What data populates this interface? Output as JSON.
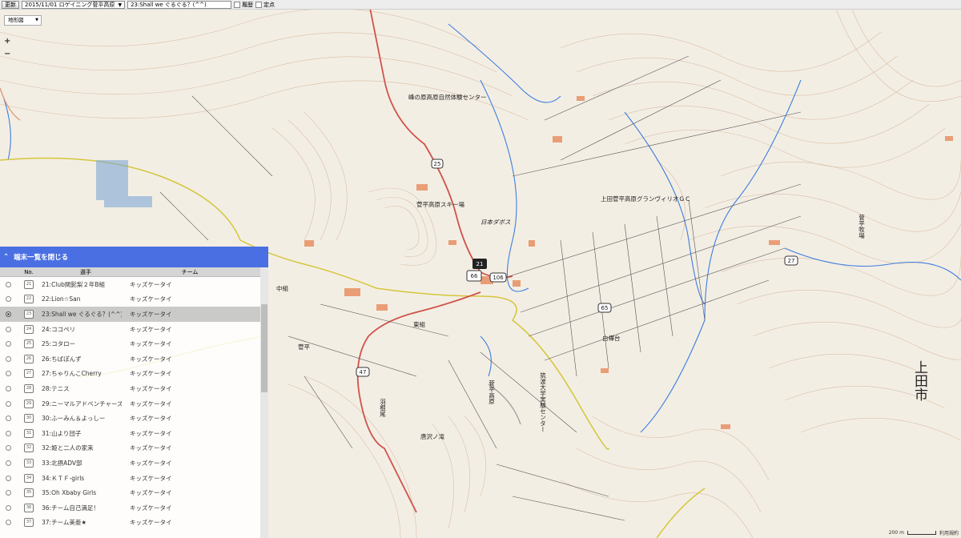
{
  "toolbar": {
    "update_label": "更新",
    "event_select": "2015/11/01 ロゲイニング菅平高原",
    "player_select": "23:Shall we ぐるぐる？(^^)",
    "history_label": "履歴",
    "fixed_point_label": "定点"
  },
  "layer_select": "地形図",
  "zoom": {
    "in": "+",
    "out": "−"
  },
  "panel": {
    "header": "端末一覧を閉じる",
    "toggle_icon": "chevron-up-icon",
    "columns": {
      "no": "No.",
      "player": "選手",
      "team": "チーム"
    },
    "rows": [
      {
        "no": "21",
        "name": "21:Club関髭梨２年B組",
        "team": "キッズケータイ"
      },
      {
        "no": "22",
        "name": "22:Lion☆San",
        "team": "キッズケータイ"
      },
      {
        "no": "23",
        "name": "23:Shall we ぐるぐる？(^^)",
        "team": "キッズケータイ"
      },
      {
        "no": "24",
        "name": "24:ココペリ",
        "team": "キッズケータイ"
      },
      {
        "no": "25",
        "name": "25:コタロー",
        "team": "キッズケータイ"
      },
      {
        "no": "26",
        "name": "26:ちばぽんず",
        "team": "キッズケータイ"
      },
      {
        "no": "27",
        "name": "27:ちゃりんこCherry",
        "team": "キッズケータイ"
      },
      {
        "no": "28",
        "name": "28:テニス",
        "team": "キッズケータイ"
      },
      {
        "no": "29",
        "name": "29:ニーマルアドベンチャーズ",
        "team": "キッズケータイ"
      },
      {
        "no": "30",
        "name": "30:ふーみん＆よっしー",
        "team": "キッズケータイ"
      },
      {
        "no": "31",
        "name": "31:山より団子",
        "team": "キッズケータイ"
      },
      {
        "no": "32",
        "name": "32:姫と二人の家来",
        "team": "キッズケータイ"
      },
      {
        "no": "33",
        "name": "33:北摂ADV部",
        "team": "キッズケータイ"
      },
      {
        "no": "34",
        "name": "34:ＫＴＦ-girls",
        "team": "キッズケータイ"
      },
      {
        "no": "35",
        "name": "35:Oh Xbaby Girls",
        "team": "キッズケータイ"
      },
      {
        "no": "36",
        "name": "36:チーム自己満足！",
        "team": "キッズケータイ"
      },
      {
        "no": "37",
        "name": "37:チーム美亜★",
        "team": "キッズケータイ"
      }
    ]
  },
  "map_labels": [
    {
      "text": "峰の原高原自然体験センター"
    },
    {
      "text": "菅平高原スキー場"
    },
    {
      "text": "日本ダボス"
    },
    {
      "text": "上田菅平高原グランヴィリオＧＣ"
    },
    {
      "text": "菅平牧場"
    },
    {
      "text": "上田市"
    },
    {
      "text": "菅平高原"
    },
    {
      "text": "筑波大学実験センター"
    },
    {
      "text": "白樺台"
    },
    {
      "text": "東組"
    },
    {
      "text": "中組"
    },
    {
      "text": "菅平"
    },
    {
      "text": "唐沢ノ滝"
    },
    {
      "text": "羽根尾"
    }
  ],
  "route_shields": [
    "25",
    "106",
    "65",
    "27",
    "47"
  ],
  "markers": [
    "21",
    "66"
  ],
  "scale": {
    "distance": "200 m",
    "terms": "利用規約"
  },
  "colors": {
    "panel_header": "#4a6fe3",
    "road_red": "#d0524a",
    "road_yellow": "#d4c63a",
    "river_blue": "#3d7ee0",
    "contour_brown": "#c9a383",
    "building_orange": "#e8956a"
  }
}
